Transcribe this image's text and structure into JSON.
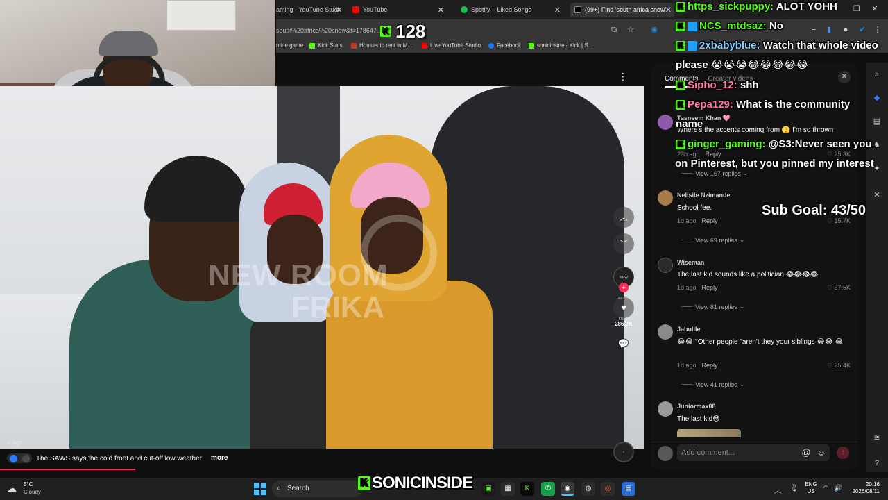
{
  "browser": {
    "tabs": [
      {
        "label": "aming - YouTube Studi",
        "favicon_color": "#ff0000"
      },
      {
        "label": "YouTube",
        "favicon_color": "#ff0000"
      },
      {
        "label": "Spotify – Liked Songs",
        "favicon_color": "#1db954"
      },
      {
        "label": "(99+) Find 'south africa snow'",
        "favicon_color": "#000000"
      }
    ],
    "url": "south%20africa%20snow&t=178647...",
    "bookmarks": [
      {
        "label": "nline game",
        "color": "#6aa84f"
      },
      {
        "label": "Kick Stats",
        "color": "#53fc18"
      },
      {
        "label": "Houses to rent in M...",
        "color": "#c0392b"
      },
      {
        "label": "Live YouTube Studio",
        "color": "#ff0000"
      },
      {
        "label": "Facebook",
        "color": "#1877f2"
      },
      {
        "label": "sonicinside - Kick | S...",
        "color": "#53fc18"
      }
    ]
  },
  "stream": {
    "viewer_count": "128",
    "sub_goal": "Sub Goal: 43/50",
    "logo_text": "SONICINSIDE",
    "logo_k": "K",
    "chat": [
      {
        "badge": "k",
        "user": "https_sickpuppy:",
        "text": "ALOT YOHH",
        "color": "green"
      },
      {
        "badge": "kb",
        "user": "NCS_mtdsaz:",
        "text": "No",
        "color": "green"
      },
      {
        "badge": "kb",
        "user": "2xbabyblue:",
        "text": "Watch that whole video",
        "color": "blue"
      },
      {
        "badge": "",
        "user": "",
        "text": "please 😭😭😭😂😂😂😂😂",
        "color": "white"
      },
      {
        "badge": "k",
        "user": "Sipho_12:",
        "text": "shh",
        "color": "pink"
      },
      {
        "badge": "k",
        "user": "Pepa129:",
        "text": "What is the community",
        "color": "pink"
      },
      {
        "badge": "",
        "user": "",
        "text": "name",
        "color": "white"
      },
      {
        "badge": "k",
        "user": "ginger_gaming:",
        "text": "@S3:Never seen you",
        "color": "green"
      },
      {
        "badge": "",
        "user": "",
        "text": "on Pinterest, but you pinned my interest",
        "color": "white"
      }
    ]
  },
  "video": {
    "watermark_line1": "NEW ROOM",
    "watermark_line2": "FRIKA",
    "time_ago": "d ago",
    "caption": "The SAWS says the cold front and cut-off low weather",
    "more_label": "more",
    "likes": "286.2K",
    "avatar_text": "NEW ROOM FRIKA",
    "progress_fraction": 0.21
  },
  "comments_panel": {
    "tabs": [
      "Comments",
      "Creator videos"
    ],
    "input_placeholder": "Add comment...",
    "comments": [
      {
        "name": "Tasneem Khan 🩷",
        "text": "Where's the accents coming from 🫣 I'm so thrown",
        "time": "23h ago",
        "reply": "Reply",
        "likes": "25.3K",
        "view": "View 167 replies",
        "avatar": "#8e5aa8"
      },
      {
        "name": "Nelisile Nzimande",
        "text": "School fee.",
        "time": "1d ago",
        "reply": "Reply",
        "likes": "15.7K",
        "view": "View 69 replies",
        "avatar": "#a57c4a"
      },
      {
        "name": "Wiseman",
        "text": "The last kid sounds like a politician 😂😂😂😂",
        "time": "1d ago",
        "reply": "Reply",
        "likes": "57.5K",
        "view": "View 81 replies",
        "avatar": "#2a2a2a"
      },
      {
        "name": "Jabulile",
        "text": "😂😂 \"Other people \"aren't they your siblings 😂😂 😂",
        "time": "1d ago",
        "reply": "Reply",
        "likes": "25.4K",
        "view": "View 41 replies",
        "avatar": "#8a8a8a"
      },
      {
        "name": "Juniormax08",
        "text": "The last kid😳",
        "time": "",
        "reply": "",
        "likes": "",
        "view": "",
        "avatar": "#9a9a9a"
      }
    ]
  },
  "taskbar": {
    "weather_temp": "5°C",
    "weather_cond": "Cloudy",
    "search_label": "Search",
    "lang_top": "ENG",
    "lang_bottom": "US",
    "time": "20:16",
    "date": "2026/08/11"
  }
}
